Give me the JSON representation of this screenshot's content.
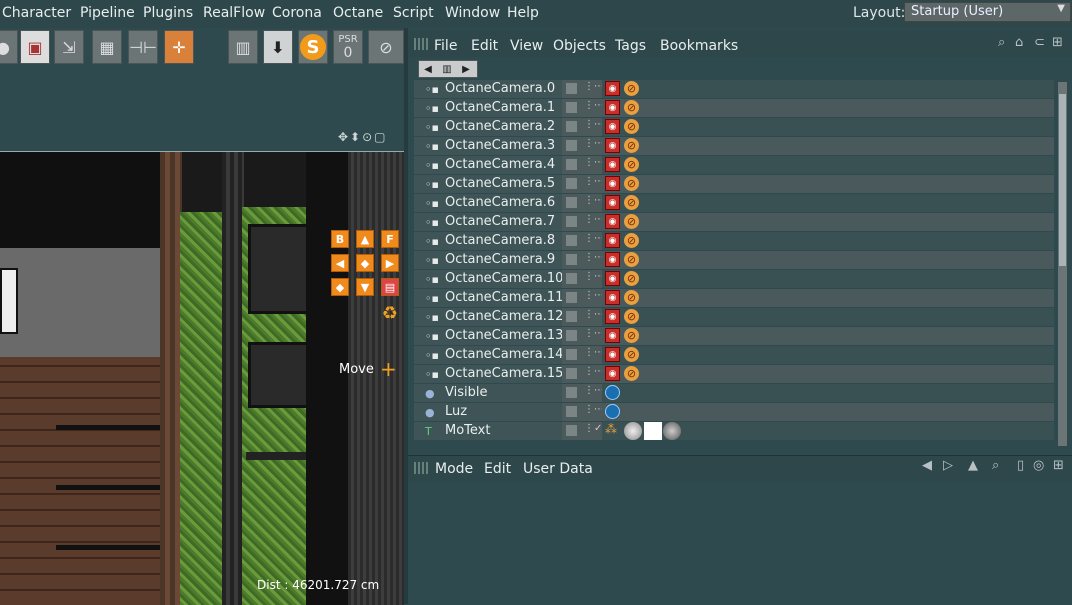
{
  "menubar": {
    "items": [
      "Character",
      "Pipeline",
      "Plugins",
      "RealFlow",
      "Corona",
      "Octane",
      "Script",
      "Window",
      "Help"
    ],
    "layout_label": "Layout:",
    "layout_value": "Startup (User)"
  },
  "toolbar": {
    "psr_label": "PSR",
    "psr_value": "0",
    "s_label": "S"
  },
  "viewport": {
    "move_label": "Move",
    "distance_label": "Dist : 46201.727 cm",
    "nav_buttons": [
      "B",
      "▲",
      "F",
      "◀",
      "▶",
      "▼"
    ]
  },
  "object_manager": {
    "menu": [
      "File",
      "Edit",
      "View",
      "Objects",
      "Tags",
      "Bookmarks"
    ],
    "objects": [
      {
        "name": "OctaneCamera.0",
        "type": "camera"
      },
      {
        "name": "OctaneCamera.1",
        "type": "camera"
      },
      {
        "name": "OctaneCamera.2",
        "type": "camera"
      },
      {
        "name": "OctaneCamera.3",
        "type": "camera"
      },
      {
        "name": "OctaneCamera.4",
        "type": "camera"
      },
      {
        "name": "OctaneCamera.5",
        "type": "camera"
      },
      {
        "name": "OctaneCamera.6",
        "type": "camera"
      },
      {
        "name": "OctaneCamera.7",
        "type": "camera"
      },
      {
        "name": "OctaneCamera.8",
        "type": "camera"
      },
      {
        "name": "OctaneCamera.9",
        "type": "camera"
      },
      {
        "name": "OctaneCamera.10",
        "type": "camera"
      },
      {
        "name": "OctaneCamera.11",
        "type": "camera"
      },
      {
        "name": "OctaneCamera.12",
        "type": "camera"
      },
      {
        "name": "OctaneCamera.13",
        "type": "camera"
      },
      {
        "name": "OctaneCamera.14",
        "type": "camera"
      },
      {
        "name": "OctaneCamera.15",
        "type": "camera"
      },
      {
        "name": "Visible",
        "type": "sphere"
      },
      {
        "name": "Luz",
        "type": "sphere"
      },
      {
        "name": "MoText",
        "type": "text"
      }
    ]
  },
  "attribute_manager": {
    "menu": [
      "Mode",
      "Edit",
      "User Data"
    ]
  }
}
